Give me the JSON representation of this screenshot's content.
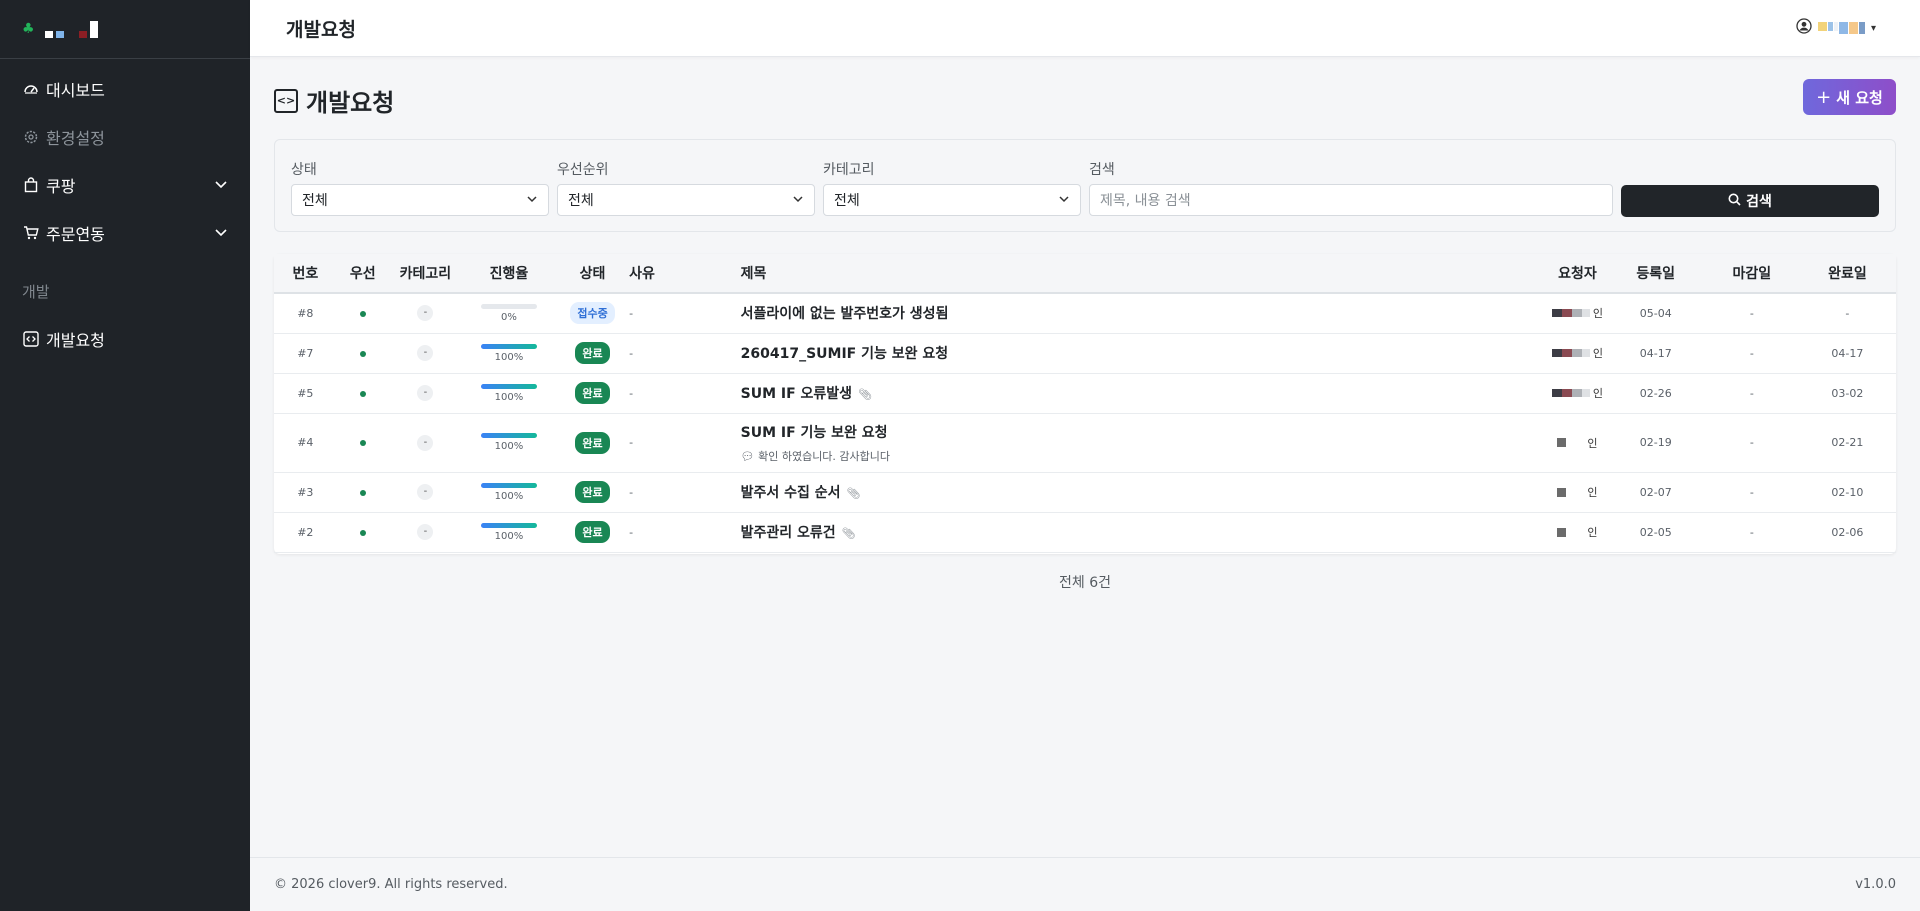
{
  "sidebar": {
    "items": [
      {
        "label": "대시보드",
        "icon": "speedometer-icon"
      },
      {
        "label": "환경설정",
        "icon": "gear-icon"
      },
      {
        "label": "쿠팡",
        "icon": "bag-icon"
      },
      {
        "label": "주문연동",
        "icon": "cart-icon"
      }
    ],
    "section_label": "개발",
    "dev_item": {
      "label": "개발요청",
      "icon": "code-icon"
    }
  },
  "header": {
    "title": "개발요청"
  },
  "page": {
    "title": "개발요청",
    "new_button": "새 요청"
  },
  "filters": {
    "status": {
      "label": "상태",
      "value": "전체"
    },
    "priority": {
      "label": "우선순위",
      "value": "전체"
    },
    "category": {
      "label": "카테고리",
      "value": "전체"
    },
    "search": {
      "label": "검색",
      "placeholder": "제목, 내용 검색"
    },
    "search_button": "검색"
  },
  "table": {
    "columns": [
      "번호",
      "우선",
      "카테고리",
      "진행율",
      "상태",
      "사유",
      "제목",
      "요청자",
      "등록일",
      "마감일",
      "완료일"
    ],
    "rows": [
      {
        "no": "#8",
        "category": "-",
        "progress": 0,
        "progress_label": "0%",
        "status": "접수중",
        "reason": "-",
        "title": "서플라이에 없는 발주번호가 생성됨",
        "requester_suffix": "인",
        "registered": "05-04",
        "due": "-",
        "completed": "-"
      },
      {
        "no": "#7",
        "category": "-",
        "progress": 100,
        "progress_label": "100%",
        "status": "완료",
        "reason": "-",
        "title": "260417_SUMIF 기능 보완 요청",
        "requester_suffix": "인",
        "registered": "04-17",
        "due": "-",
        "completed": "04-17"
      },
      {
        "no": "#5",
        "category": "-",
        "progress": 100,
        "progress_label": "100%",
        "status": "완료",
        "reason": "-",
        "title": "SUM IF 오류발생",
        "requester_suffix": "인",
        "registered": "02-26",
        "due": "-",
        "completed": "03-02"
      },
      {
        "no": "#4",
        "category": "-",
        "progress": 100,
        "progress_label": "100%",
        "status": "완료",
        "reason": "-",
        "title": "SUM IF 기능 보완 요청",
        "comment": "확인 하였습니다. 감사합니다",
        "requester_suffix": "인",
        "registered": "02-19",
        "due": "-",
        "completed": "02-21"
      },
      {
        "no": "#3",
        "category": "-",
        "progress": 100,
        "progress_label": "100%",
        "status": "완료",
        "reason": "-",
        "title": "발주서 수집 순서",
        "requester_suffix": "인",
        "registered": "02-07",
        "due": "-",
        "completed": "02-10"
      },
      {
        "no": "#2",
        "category": "-",
        "progress": 100,
        "progress_label": "100%",
        "status": "완료",
        "reason": "-",
        "title": "발주관리 오류건",
        "requester_suffix": "인",
        "registered": "02-05",
        "due": "-",
        "completed": "02-06"
      }
    ]
  },
  "total_label": "전체 6건",
  "footer": {
    "copyright": "© 2026 clover9. All rights reserved.",
    "version": "v1.0.0"
  },
  "colors": {
    "sidebar_bg": "#1f2328",
    "done_badge": "#198754",
    "accent_gradient_start": "#6f68dc",
    "accent_gradient_end": "#8e4ec9"
  }
}
